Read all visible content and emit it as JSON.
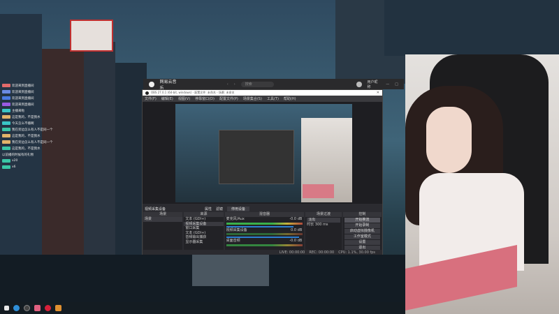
{
  "netease": {
    "app_name": "网易云音乐",
    "search_placeholder": "搜索",
    "user": "用户昵称"
  },
  "obs": {
    "title": "OBS 27.0.1 (64-bit, windows) - 配置文件: 未命名 - 场景: 未命名",
    "menu": [
      "文件(F)",
      "编辑(E)",
      "视图(V)",
      "停靠窗口(D)",
      "配置文件(P)",
      "场景集合(S)",
      "工具(T)",
      "帮助(H)"
    ],
    "dock_label": "视频采集设备",
    "props_label": "属性",
    "filters_label": "滤镜",
    "deactivate_label": "停用设备",
    "scenes": {
      "header": "场景",
      "items": [
        "场景"
      ]
    },
    "sources": {
      "header": "来源",
      "items": [
        "文本 (GDI+)",
        "视频采集设备",
        "窗口采集",
        "文本 (GDI+)",
        "音频输出捕获",
        "显示器采集"
      ]
    },
    "mixer": {
      "header": "混音器",
      "channels": [
        {
          "name": "麦克风/Aux",
          "db": "-0.0 dB",
          "level": 0.75
        },
        {
          "name": "视频采集设备",
          "db": "0.0 dB",
          "level": 0.9
        },
        {
          "name": "桌面音频",
          "db": "-0.0 dB",
          "level": 0.6
        }
      ]
    },
    "transitions": {
      "header": "场景过渡",
      "type": "淡出",
      "duration_label": "时长",
      "duration": "300 ms"
    },
    "controls": {
      "header": "控制",
      "buttons": [
        "开始推流",
        "开始录制",
        "启动虚拟摄像机",
        "工作室模式",
        "设置",
        "退出"
      ]
    },
    "status": {
      "live": "LIVE: 00:00:00",
      "rec": "REC: 00:00:00",
      "cpu": "CPU: 1.1%, 30.00 fps"
    }
  },
  "chat": {
    "messages": [
      "欢迎来到直播间",
      "欢迎来到直播间",
      "欢迎来到直播间",
      "欢迎来到直播间",
      "主播来啦",
      "这是我的，不是我水",
      "今天怎么不播啊",
      "我在旁边怎么有人不是同一个",
      "这是我的，不是我水",
      "我在旁边怎么有人不是同一个",
      "这是我的，不是我水",
      "以前播的时候有的礼物",
      "x20",
      "x6"
    ]
  },
  "colors": {
    "obs_bg": "#2b2b30",
    "accent": "#2d7fd2",
    "taskbar": "#141c22"
  }
}
